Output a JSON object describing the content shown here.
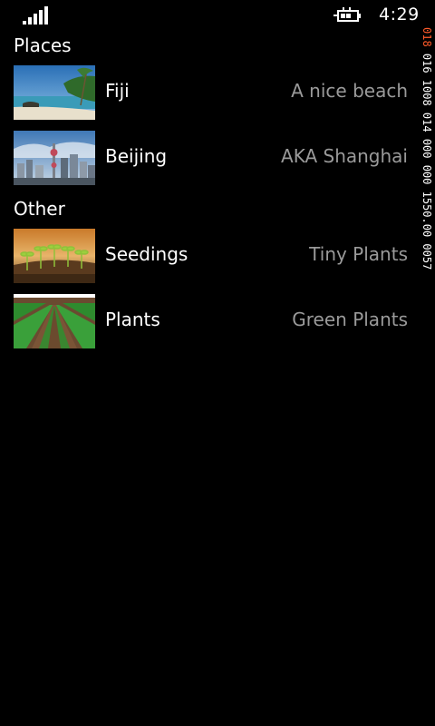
{
  "status_bar": {
    "time": "4:29",
    "signal_icon": "signal-strength-icon",
    "battery_icon": "battery-charging-icon"
  },
  "fps_counter": {
    "accent": "018",
    "rest": " 016 1008 014 000 000 1550.00 0057"
  },
  "groups": [
    {
      "header": "Places",
      "items": [
        {
          "title": "Fiji",
          "subtitle": "A nice beach",
          "thumbnail": "beach-photo"
        },
        {
          "title": "Beijing",
          "subtitle": "AKA Shanghai",
          "thumbnail": "city-skyline-photo"
        }
      ]
    },
    {
      "header": "Other",
      "items": [
        {
          "title": "Seedings",
          "subtitle": "Tiny Plants",
          "thumbnail": "seedlings-photo"
        },
        {
          "title": "Plants",
          "subtitle": "Green Plants",
          "thumbnail": "crop-rows-photo"
        }
      ]
    }
  ],
  "colors": {
    "background": "#000000",
    "title": "#ffffff",
    "subtitle": "#9a9a9a",
    "counter_accent": "#ff5a2a"
  }
}
